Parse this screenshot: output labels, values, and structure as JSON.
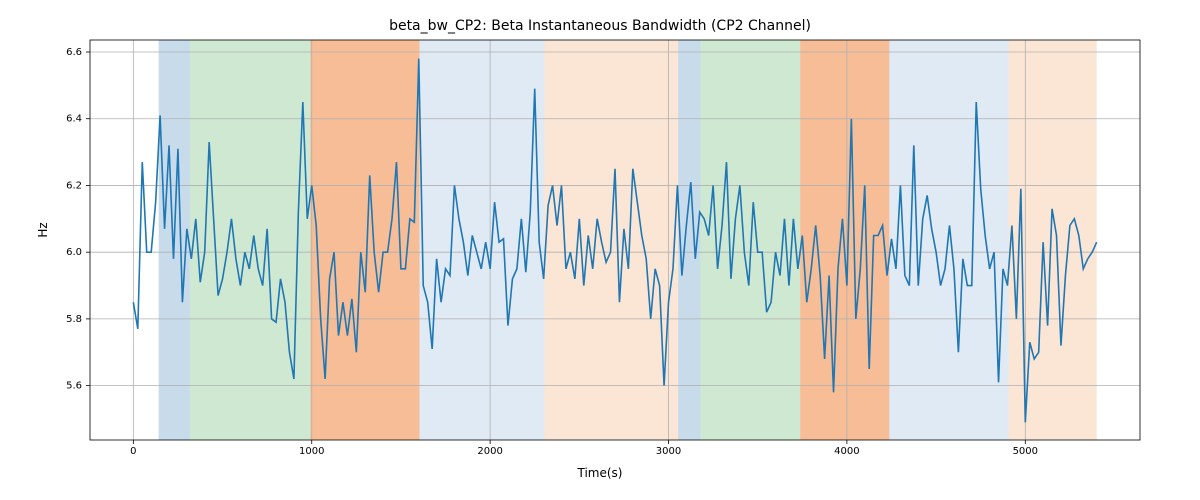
{
  "chart_data": {
    "type": "line",
    "title": "beta_bw_CP2: Beta Instantaneous Bandwidth (CP2 Channel)",
    "xlabel": "Time(s)",
    "ylabel": "Hz",
    "xlim": [
      -243,
      5643
    ],
    "ylim": [
      5.437,
      6.636
    ],
    "xticks": [
      0,
      1000,
      2000,
      3000,
      4000,
      5000
    ],
    "yticks": [
      5.6,
      5.8,
      6.0,
      6.2,
      6.4,
      6.6
    ],
    "spans": [
      {
        "x0": 142,
        "x1": 317,
        "color": "#6098c7",
        "alpha": 0.35
      },
      {
        "x0": 317,
        "x1": 992,
        "color": "#76bd7f",
        "alpha": 0.35
      },
      {
        "x0": 992,
        "x1": 1604,
        "color": "#ee8740",
        "alpha": 0.55
      },
      {
        "x0": 1604,
        "x1": 2304,
        "color": "#6098c7",
        "alpha": 0.2
      },
      {
        "x0": 2304,
        "x1": 3054,
        "color": "#ee8740",
        "alpha": 0.22
      },
      {
        "x0": 3054,
        "x1": 3179,
        "color": "#6098c7",
        "alpha": 0.35
      },
      {
        "x0": 3179,
        "x1": 3738,
        "color": "#76bd7f",
        "alpha": 0.35
      },
      {
        "x0": 3738,
        "x1": 4238,
        "color": "#ee8740",
        "alpha": 0.55
      },
      {
        "x0": 4238,
        "x1": 4906,
        "color": "#6098c7",
        "alpha": 0.2
      },
      {
        "x0": 4906,
        "x1": 5400,
        "color": "#ee8740",
        "alpha": 0.22
      }
    ],
    "x": [
      0,
      25,
      50,
      75,
      100,
      125,
      150,
      175,
      200,
      225,
      250,
      275,
      300,
      325,
      350,
      375,
      400,
      425,
      450,
      475,
      500,
      525,
      550,
      575,
      600,
      625,
      650,
      675,
      700,
      725,
      750,
      775,
      800,
      825,
      850,
      875,
      900,
      925,
      950,
      975,
      1000,
      1025,
      1050,
      1075,
      1100,
      1125,
      1150,
      1175,
      1200,
      1225,
      1250,
      1275,
      1300,
      1325,
      1350,
      1375,
      1400,
      1425,
      1450,
      1475,
      1500,
      1525,
      1550,
      1575,
      1600,
      1625,
      1650,
      1675,
      1700,
      1725,
      1750,
      1775,
      1800,
      1825,
      1850,
      1875,
      1900,
      1925,
      1950,
      1975,
      2000,
      2025,
      2050,
      2075,
      2100,
      2125,
      2150,
      2175,
      2200,
      2225,
      2250,
      2275,
      2300,
      2325,
      2350,
      2375,
      2400,
      2425,
      2450,
      2475,
      2500,
      2525,
      2550,
      2575,
      2600,
      2625,
      2650,
      2675,
      2700,
      2725,
      2750,
      2775,
      2800,
      2825,
      2850,
      2875,
      2900,
      2925,
      2950,
      2975,
      3000,
      3025,
      3050,
      3075,
      3100,
      3125,
      3150,
      3175,
      3200,
      3225,
      3250,
      3275,
      3300,
      3325,
      3350,
      3375,
      3400,
      3425,
      3450,
      3475,
      3500,
      3525,
      3550,
      3575,
      3600,
      3625,
      3650,
      3675,
      3700,
      3725,
      3750,
      3775,
      3800,
      3825,
      3850,
      3875,
      3900,
      3925,
      3950,
      3975,
      4000,
      4025,
      4050,
      4075,
      4100,
      4125,
      4150,
      4175,
      4200,
      4225,
      4250,
      4275,
      4300,
      4325,
      4350,
      4375,
      4400,
      4425,
      4450,
      4475,
      4500,
      4525,
      4550,
      4575,
      4600,
      4625,
      4650,
      4675,
      4700,
      4725,
      4750,
      4775,
      4800,
      4825,
      4850,
      4875,
      4900,
      4925,
      4950,
      4975,
      5000,
      5025,
      5050,
      5075,
      5100,
      5125,
      5150,
      5175,
      5200,
      5225,
      5250,
      5275,
      5300,
      5325,
      5350,
      5375,
      5400
    ],
    "y": [
      5.85,
      5.77,
      6.27,
      6.0,
      6.0,
      6.15,
      6.41,
      6.07,
      6.32,
      5.98,
      6.31,
      5.85,
      6.07,
      5.98,
      6.1,
      5.91,
      6.0,
      6.33,
      6.1,
      5.87,
      5.92,
      6.0,
      6.1,
      5.98,
      5.9,
      6.0,
      5.95,
      6.05,
      5.95,
      5.9,
      6.07,
      5.8,
      5.79,
      5.92,
      5.85,
      5.7,
      5.62,
      6.12,
      6.45,
      6.1,
      6.2,
      6.08,
      5.8,
      5.62,
      5.92,
      6.0,
      5.75,
      5.85,
      5.75,
      5.86,
      5.7,
      6.0,
      5.88,
      6.23,
      6.0,
      5.88,
      6.0,
      6.0,
      6.1,
      6.27,
      5.95,
      5.95,
      6.1,
      6.09,
      6.58,
      5.9,
      5.85,
      5.71,
      5.98,
      5.85,
      5.95,
      5.93,
      6.2,
      6.1,
      6.03,
      5.93,
      6.05,
      6.0,
      5.95,
      6.03,
      5.95,
      6.15,
      6.03,
      6.04,
      5.78,
      5.92,
      5.95,
      6.1,
      5.94,
      6.12,
      6.49,
      6.03,
      5.92,
      6.14,
      6.2,
      6.08,
      6.2,
      5.95,
      6.0,
      5.92,
      6.1,
      5.9,
      6.05,
      5.95,
      6.1,
      6.03,
      5.97,
      6.0,
      6.25,
      5.85,
      6.07,
      5.95,
      6.25,
      6.15,
      6.05,
      5.98,
      5.8,
      5.95,
      5.9,
      5.6,
      5.85,
      5.95,
      6.2,
      5.93,
      6.08,
      6.21,
      5.98,
      6.12,
      6.1,
      6.05,
      6.2,
      5.95,
      6.08,
      6.27,
      5.92,
      6.1,
      6.2,
      6.0,
      5.9,
      6.15,
      6.0,
      6.0,
      5.82,
      5.85,
      6.0,
      5.93,
      6.1,
      5.9,
      6.1,
      5.95,
      6.05,
      5.85,
      5.95,
      6.08,
      5.93,
      5.68,
      5.93,
      5.58,
      5.95,
      6.1,
      5.9,
      6.4,
      5.8,
      5.95,
      6.2,
      5.65,
      6.05,
      6.05,
      6.08,
      5.93,
      6.04,
      5.95,
      6.2,
      5.93,
      5.9,
      6.32,
      5.9,
      6.1,
      6.17,
      6.07,
      6.0,
      5.9,
      5.95,
      6.08,
      5.95,
      5.7,
      5.98,
      5.9,
      5.9,
      6.45,
      6.19,
      6.05,
      5.95,
      6.0,
      5.61,
      5.95,
      5.9,
      6.08,
      5.8,
      6.19,
      5.49,
      5.73,
      5.68,
      5.7,
      6.03,
      5.78,
      6.13,
      6.05,
      5.72,
      5.93,
      6.08,
      6.1,
      6.05,
      5.95,
      5.98,
      6.0,
      6.03
    ]
  }
}
